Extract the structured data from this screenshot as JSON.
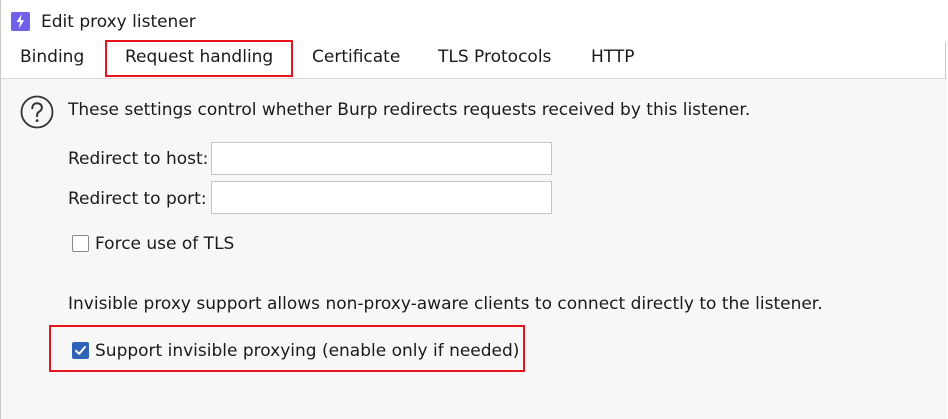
{
  "window": {
    "title": "Edit proxy listener",
    "icon": "burp-lightning-icon",
    "icon_color": "#7160e8"
  },
  "tabs": [
    {
      "label": "Binding",
      "active": false
    },
    {
      "label": "Request handling",
      "active": true
    },
    {
      "label": "Certificate",
      "active": false
    },
    {
      "label": "TLS Protocols",
      "active": false
    },
    {
      "label": "HTTP",
      "active": false
    }
  ],
  "panel": {
    "help_icon": "question-circle-icon",
    "description": "These settings control whether Burp redirects requests received by this listener.",
    "redirect_host": {
      "label": "Redirect to host:",
      "value": ""
    },
    "redirect_port": {
      "label": "Redirect to port:",
      "value": ""
    },
    "force_tls": {
      "label": "Force use of TLS",
      "checked": false
    },
    "invisible_description": "Invisible proxy support allows non-proxy-aware clients to connect directly to the listener.",
    "invisible_proxying": {
      "label": "Support invisible proxying (enable only if needed)",
      "checked": true
    }
  },
  "colors": {
    "highlight": "#e8141b",
    "checkbox_checked": "#2f63b5",
    "panel_background": "#f7f7f7"
  }
}
